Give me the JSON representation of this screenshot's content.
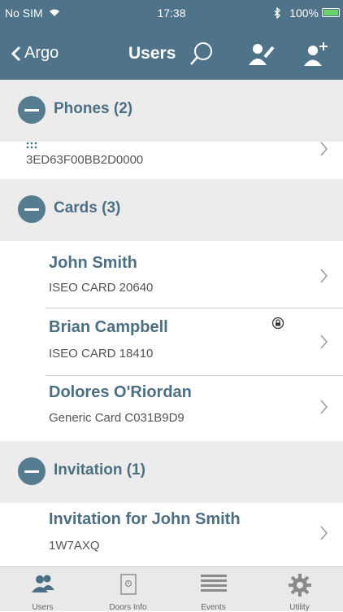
{
  "status_bar": {
    "carrier": "No SIM",
    "time": "17:38",
    "battery": "100%"
  },
  "nav": {
    "back_label": "Argo",
    "title": "Users",
    "icons": [
      "search-icon",
      "edit-user-icon",
      "add-user-icon"
    ]
  },
  "sections": [
    {
      "title": "Phones (2)",
      "items": [
        {
          "subtitle": "3ED63F00BB2D0000"
        }
      ]
    },
    {
      "title": "Cards (3)",
      "items": [
        {
          "name": "John Smith",
          "subtitle": "ISEO CARD 20640"
        },
        {
          "name": "Brian Campbell",
          "subtitle": "ISEO CARD 18410",
          "badge": "lock-icon"
        },
        {
          "name": "Dolores O'Riordan",
          "subtitle": "Generic Card C031B9D9"
        }
      ]
    },
    {
      "title": "Invitation (1)",
      "items": [
        {
          "name": "Invitation for John Smith",
          "subtitle": "1W7AXQ"
        }
      ]
    }
  ],
  "tabs": [
    {
      "label": "Users",
      "icon": "users-icon"
    },
    {
      "label": "Doors Info",
      "icon": "door-icon"
    },
    {
      "label": "Events",
      "icon": "list-icon"
    },
    {
      "label": "Utility",
      "icon": "gear-icon"
    }
  ],
  "colors": {
    "header": "#4f7388",
    "accent_text": "#4d6f83",
    "section_bg": "#ececec"
  }
}
